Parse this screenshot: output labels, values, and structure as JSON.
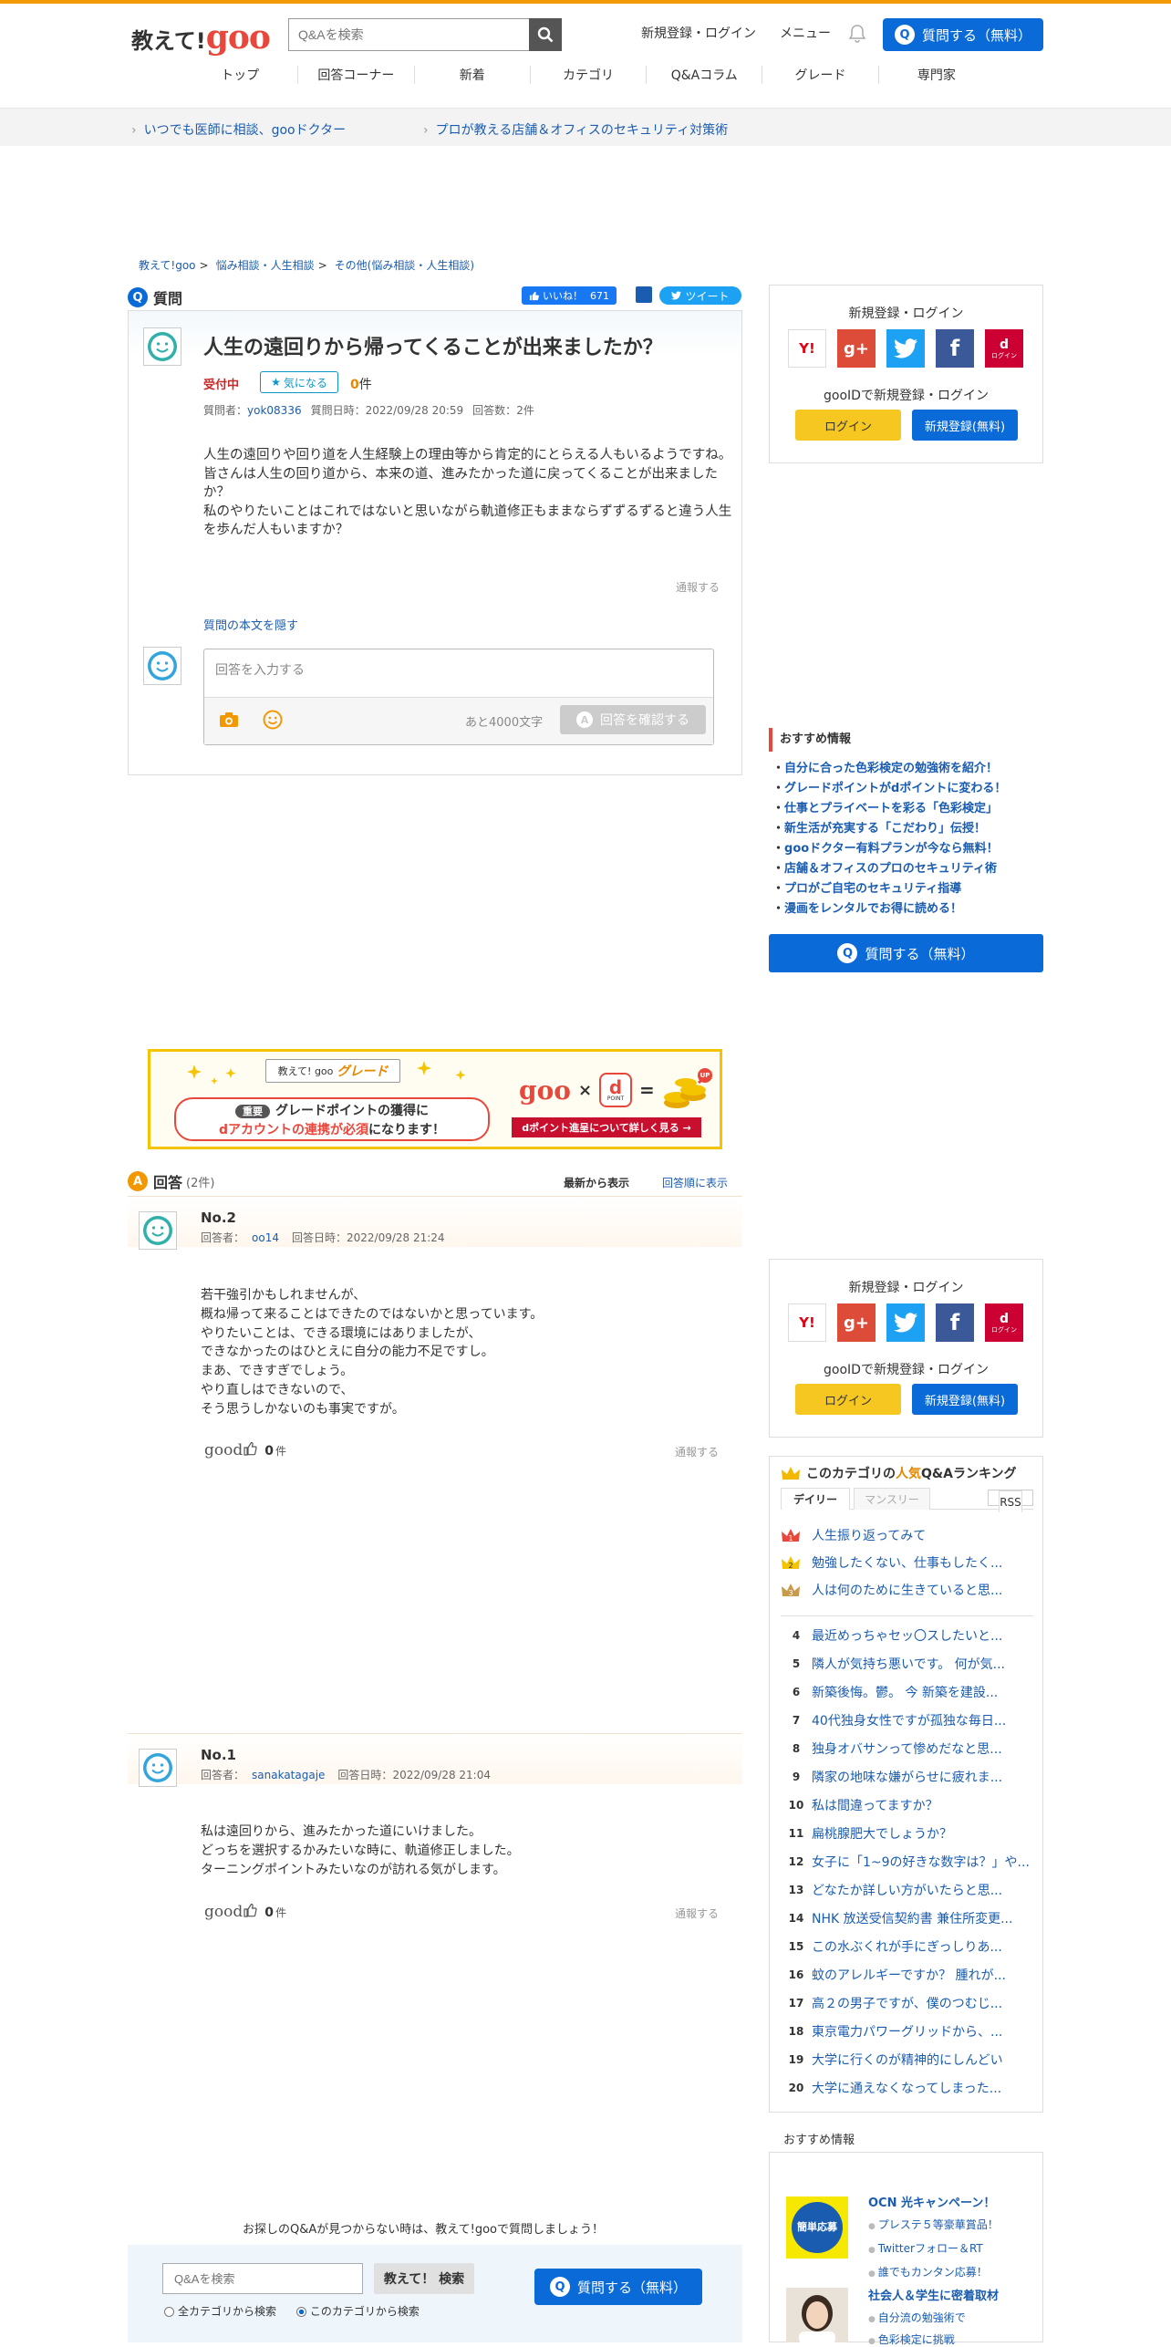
{
  "header": {
    "logo_text": "教えて!",
    "logo_goo": "goo",
    "search_placeholder": "Q&Aを検索",
    "login_link": "新規登録・ログイン",
    "menu_link": "メニュー",
    "ask_button": "質問する（無料）",
    "ask_icon_letter": "Q"
  },
  "nav": [
    "トップ",
    "回答コーナー",
    "新着",
    "カテゴリ",
    "Q&Aコラム",
    "グレード",
    "専門家"
  ],
  "promo_links": [
    "いつでも医師に相談、gooドクター",
    "プロが教える店舗＆オフィスのセキュリティ対策術"
  ],
  "breadcrumb": [
    "教えて!goo",
    "悩み相談・人生相談",
    "その他(悩み相談・人生相談)"
  ],
  "breadcrumb_sep": ">",
  "question": {
    "section_label": "質問",
    "section_icon": "Q",
    "like_label": "いいね！",
    "like_count": "671",
    "tweet_label": "ツイート",
    "title": "人生の遠回りから帰ってくることが出来ましたか？",
    "status": "受付中",
    "watch_label": "気になる",
    "watch_count": "0",
    "watch_unit": "件",
    "asker_label": "質問者：",
    "asker": "yok08336",
    "date_label": "質問日時：",
    "date": "2022/09/28 20:59",
    "answers_label": "回答数：",
    "answers_count": "2件",
    "body": [
      "人生の遠回りや回り道を人生経験上の理由等から肯定的にとらえる人もいるようですね。",
      "皆さんは人生の回り道から、本来の道、進みたかった道に戻ってくることが出来ましたか？",
      "私のやりたいことはこれではないと思いながら軌道修正もままならずずるずると違う人生を歩んだ人もいますか？"
    ],
    "report": "通報する",
    "hide_body": "質問の本文を隠す"
  },
  "answer_input": {
    "placeholder": "回答を入力する",
    "remaining": "あと4000文字",
    "confirm_button": "回答を確認する",
    "confirm_icon": "A"
  },
  "banner": {
    "brand": "教えて! goo",
    "title": "グレード",
    "tag": "重要",
    "line1": "グレードポイントの獲得に",
    "line2_em": "dアカウントの連携が必須",
    "line2_rest": "になります！",
    "goo": "goo",
    "times": "×",
    "d_label": "d",
    "d_sub": "POINT",
    "equals": "=",
    "badge": "UP",
    "cta": "dポイント進呈について詳しく見る →"
  },
  "answers_section": {
    "label": "回答",
    "icon": "A",
    "count": "(2件)",
    "sort_newest": "最新から表示",
    "sort_order": "回答順に表示"
  },
  "answers": [
    {
      "no": "No.2",
      "user_label": "回答者：",
      "user": "oo14",
      "date_label": "回答日時：",
      "date": "2022/09/28 21:24",
      "body": [
        "若干強引かもしれませんが、",
        "概ね帰って来ることはできたのではないかと思っています。",
        "やりたいことは、できる環境にはありましたが、",
        "できなかったのはひとえに自分の能力不足ですし。",
        "まあ、できすぎでしょう。",
        "やり直しはできないので、",
        "そう思うしかないのも事実ですが。"
      ],
      "good_label": "good",
      "good_count": "0",
      "good_unit": "件",
      "report": "通報する"
    },
    {
      "no": "No.1",
      "user_label": "回答者：",
      "user": "sanakatagaje",
      "date_label": "回答日時：",
      "date": "2022/09/28 21:04",
      "body": [
        "私は遠回りから、進みたかった道にいけました。",
        "どっちを選択するかみたいな時に、軌道修正しました。",
        "ターニングポイントみたいなのが訪れる気がします。"
      ],
      "good_label": "good",
      "good_count": "0",
      "good_unit": "件",
      "report": "通報する"
    }
  ],
  "bottom": {
    "prompt": "お探しのQ&Aが見つからない時は、教えて!gooで質問しましょう！",
    "search_placeholder": "Q&Aを検索",
    "search_button": "教えて！ 検索",
    "radio_all": "全カテゴリから検索",
    "radio_this": "このカテゴリから検索",
    "ask_button": "質問する（無料）"
  },
  "sidebar": {
    "login": {
      "title": "新規登録・ログイン",
      "gooid": "gooIDで新規登録・ログイン",
      "login_button": "ログイン",
      "register_button": "新規登録(無料)",
      "social_labels": [
        "Y!",
        "g+",
        "",
        "f",
        "d"
      ],
      "docomo_sub": "ログイン"
    },
    "recommend_title": "おすすめ情報",
    "recommend": [
      "自分に合った色彩検定の勉強術を紹介！",
      "グレードポイントがdポイントに変わる！",
      "仕事とプライベートを彩る「色彩検定」",
      "新生活が充実する「こだわり」伝授！",
      "gooドクター有料プランが今なら無料！",
      "店舗＆オフィスのプロのセキュリティ術",
      "プロがご自宅のセキュリティ指導",
      "漫画をレンタルでお得に読める！"
    ],
    "ask_button": "質問する（無料）",
    "ranking": {
      "title_pre": "このカテゴリの",
      "title_em": "人気",
      "title_post": "Q&Aランキング",
      "tab_daily": "デイリー",
      "tab_monthly": "マンスリー",
      "rss": "RSS",
      "items": [
        {
          "rank": "1",
          "title": "人生振り返ってみて"
        },
        {
          "rank": "2",
          "title": "勉強したくない、仕事もしたく..."
        },
        {
          "rank": "3",
          "title": "人は何のために生きていると思..."
        },
        {
          "rank": "4",
          "title": "最近めっちゃセッ〇スしたいと..."
        },
        {
          "rank": "5",
          "title": "隣人が気持ち悪いです。 何が気..."
        },
        {
          "rank": "6",
          "title": "新築後悔。鬱。 今 新築を建設..."
        },
        {
          "rank": "7",
          "title": "40代独身女性ですが孤独な毎日..."
        },
        {
          "rank": "8",
          "title": "独身オバサンって惨めだなと思..."
        },
        {
          "rank": "9",
          "title": "隣家の地味な嫌がらせに疲れま..."
        },
        {
          "rank": "10",
          "title": "私は間違ってますか？"
        },
        {
          "rank": "11",
          "title": "扁桃腺肥大でしょうか？"
        },
        {
          "rank": "12",
          "title": "女子に「1~9の好きな数字は？」や..."
        },
        {
          "rank": "13",
          "title": "どなたか詳しい方がいたらと思..."
        },
        {
          "rank": "14",
          "title": "NHK 放送受信契約書 兼住所変更..."
        },
        {
          "rank": "15",
          "title": "この水ぶくれが手にぎっしりあ..."
        },
        {
          "rank": "16",
          "title": "蚊のアレルギーですか？ 腫れが..."
        },
        {
          "rank": "17",
          "title": "高２の男子ですが、僕のつむじ..."
        },
        {
          "rank": "18",
          "title": "東京電力パワーグリッドから、..."
        },
        {
          "rank": "19",
          "title": "大学に行くのが精神的にしんどい"
        },
        {
          "rank": "20",
          "title": "大学に通えなくなってしまった..."
        }
      ]
    },
    "recommend2": {
      "title": "おすすめ情報",
      "campaign_badge": "簡単応募",
      "campaign_title": "OCN 光キャンペーン！",
      "campaign_links": [
        "プレステ５等豪華賞品！",
        "Twitterフォロー＆RT",
        "誰でもカンタン応募！"
      ],
      "article_title": "社会人＆学生に密着取材",
      "article_links": [
        "自分流の勉強術で",
        "色彩検定に挑戦"
      ]
    }
  }
}
